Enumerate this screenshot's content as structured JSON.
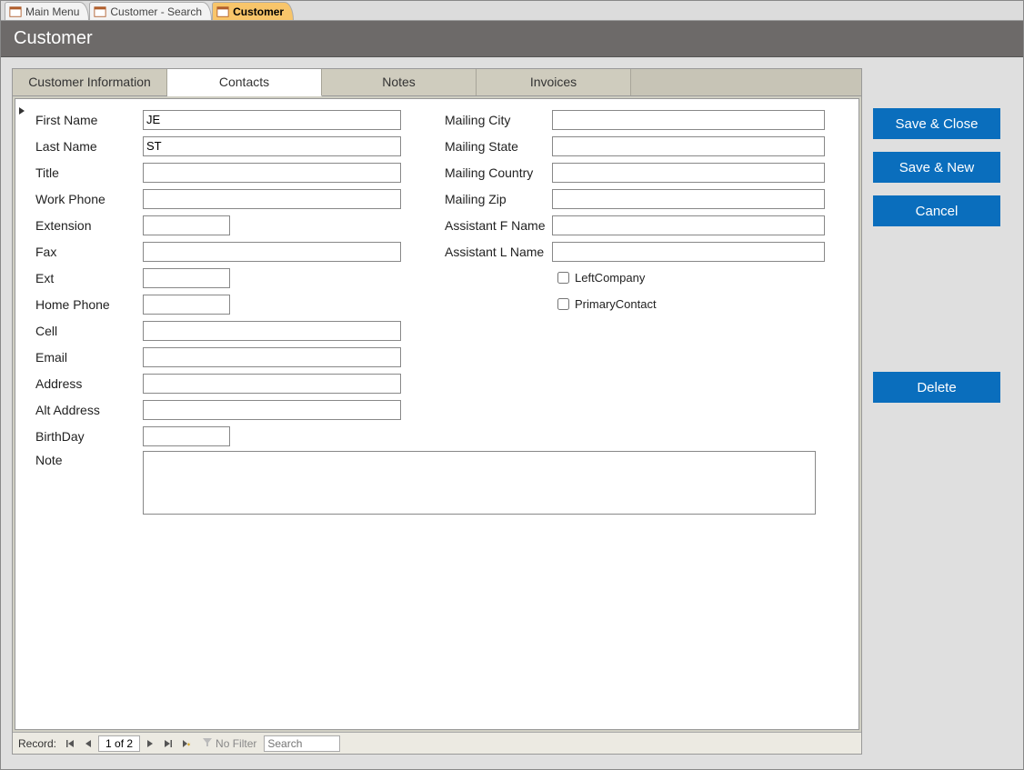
{
  "doc_tabs": {
    "main_menu": "Main Menu",
    "customer_search": "Customer - Search",
    "customer": "Customer"
  },
  "header": {
    "title": "Customer"
  },
  "inner_tabs": {
    "customer_info": "Customer Information",
    "contacts": "Contacts",
    "notes": "Notes",
    "invoices": "Invoices"
  },
  "fields": {
    "first_name": {
      "label": "First Name",
      "value": "JE"
    },
    "last_name": {
      "label": "Last Name",
      "value": "ST"
    },
    "title": {
      "label": "Title",
      "value": ""
    },
    "work_phone": {
      "label": "Work Phone",
      "value": ""
    },
    "extension": {
      "label": "Extension",
      "value": ""
    },
    "fax": {
      "label": "Fax",
      "value": ""
    },
    "ext": {
      "label": "Ext",
      "value": ""
    },
    "home_phone": {
      "label": "Home Phone",
      "value": ""
    },
    "cell": {
      "label": "Cell",
      "value": ""
    },
    "email": {
      "label": "Email",
      "value": ""
    },
    "address": {
      "label": "Address",
      "value": ""
    },
    "alt_address": {
      "label": "Alt Address",
      "value": ""
    },
    "birthday": {
      "label": "BirthDay",
      "value": ""
    },
    "mailing_city": {
      "label": "Mailing City",
      "value": ""
    },
    "mailing_state": {
      "label": "Mailing State",
      "value": ""
    },
    "mailing_country": {
      "label": "Mailing Country",
      "value": ""
    },
    "mailing_zip": {
      "label": "Mailing Zip",
      "value": ""
    },
    "assistant_fname": {
      "label": "Assistant F Name",
      "value": ""
    },
    "assistant_lname": {
      "label": "Assistant L Name",
      "value": ""
    },
    "left_company": {
      "label": "LeftCompany"
    },
    "primary_contact": {
      "label": "PrimaryContact"
    },
    "note": {
      "label": "Note",
      "value": ""
    }
  },
  "record_nav": {
    "label": "Record:",
    "position": "1 of 2",
    "no_filter": "No Filter",
    "search_placeholder": "Search"
  },
  "buttons": {
    "save_close": "Save & Close",
    "save_new": "Save & New",
    "cancel": "Cancel",
    "delete": "Delete"
  }
}
